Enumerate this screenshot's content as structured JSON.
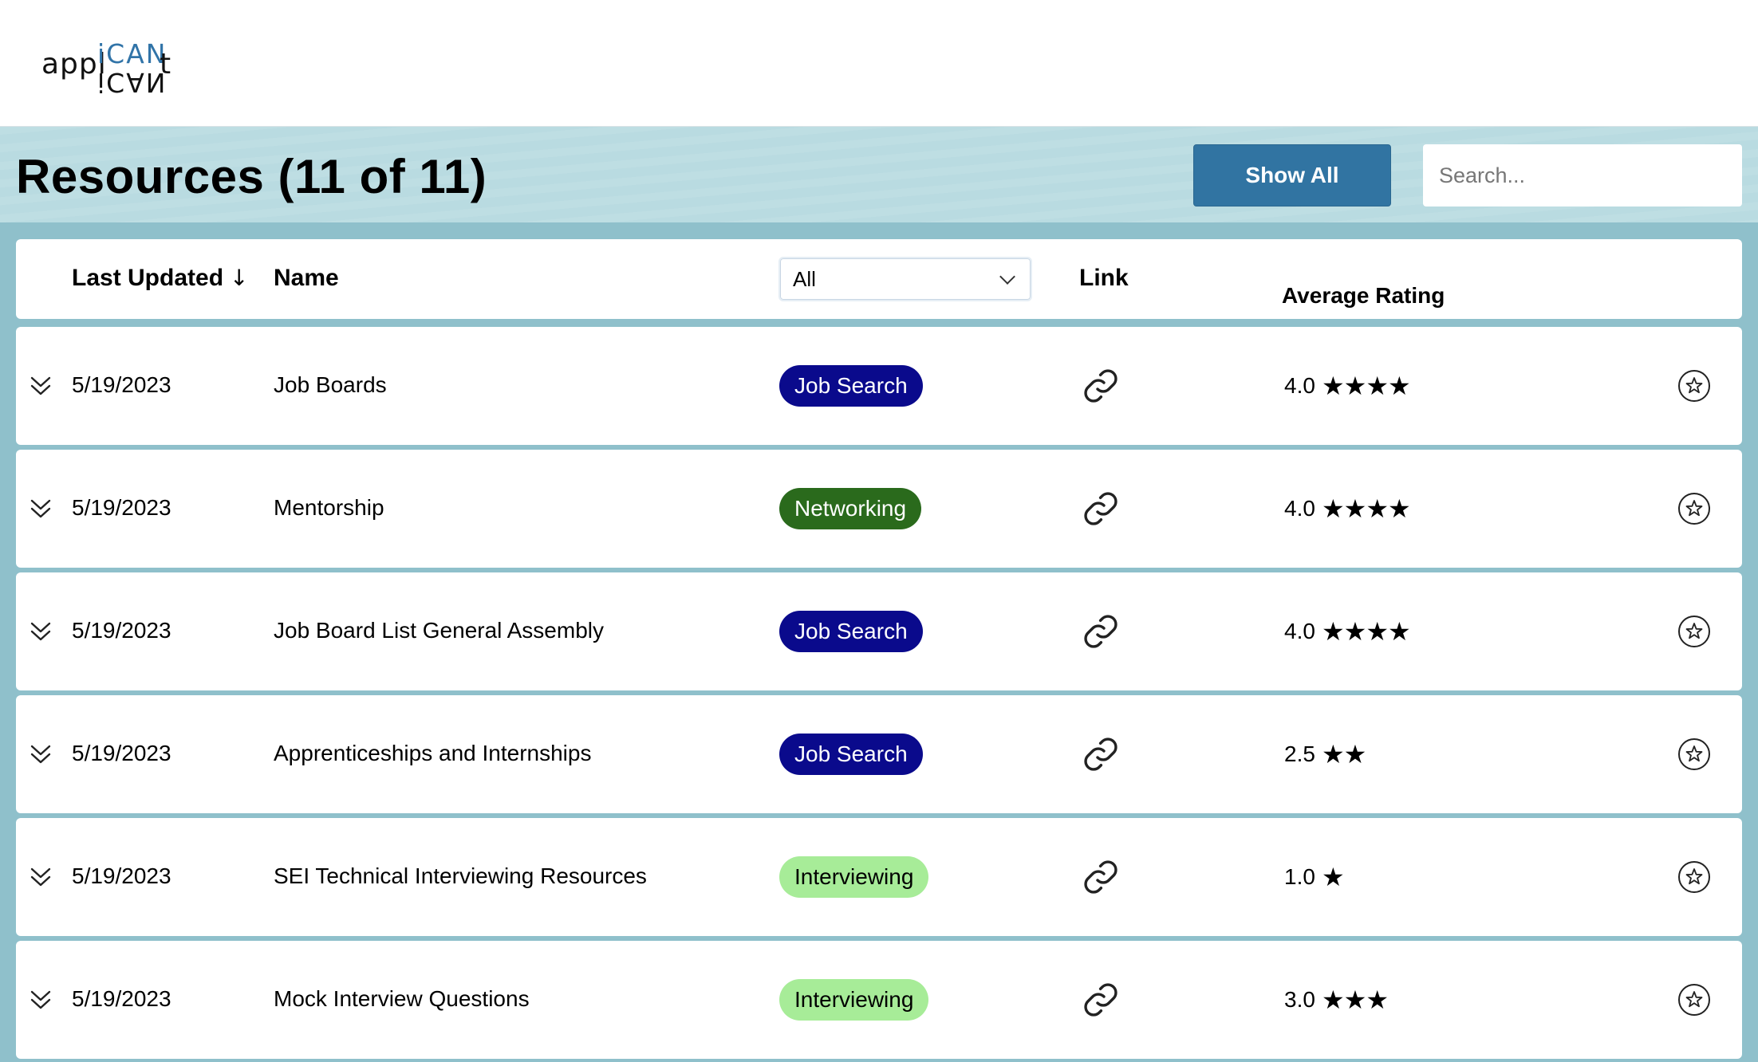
{
  "app": {
    "logo_left": "appl",
    "logo_can": "iCAN",
    "logo_right": "t"
  },
  "toolbar": {
    "title": "Resources (11 of 11)",
    "show_all_label": "Show All",
    "search_placeholder": "Search...",
    "search_value": ""
  },
  "table": {
    "headers": {
      "last_updated": "Last Updated",
      "sort_indicator": "↓",
      "name": "Name",
      "category_filter": "All",
      "link": "Link",
      "average_rating": "Average Rating"
    },
    "rows": [
      {
        "date": "5/19/2023",
        "name": "Job Boards",
        "category": "Job Search",
        "rating": "4.0",
        "stars": "★★★★"
      },
      {
        "date": "5/19/2023",
        "name": "Mentorship",
        "category": "Networking",
        "rating": "4.0",
        "stars": "★★★★"
      },
      {
        "date": "5/19/2023",
        "name": "Job Board List General Assembly",
        "category": "Job Search",
        "rating": "4.0",
        "stars": "★★★★"
      },
      {
        "date": "5/19/2023",
        "name": "Apprenticeships and Internships",
        "category": "Job Search",
        "rating": "2.5",
        "stars": "★★"
      },
      {
        "date": "5/19/2023",
        "name": "SEI Technical Interviewing Resources",
        "category": "Interviewing",
        "rating": "1.0",
        "stars": "★"
      },
      {
        "date": "5/19/2023",
        "name": "Mock Interview Questions",
        "category": "Interviewing",
        "rating": "3.0",
        "stars": "★★★"
      }
    ]
  },
  "colors": {
    "accent": "#3174a2",
    "page_background": "#8fc0cb",
    "title_band": "#b9dbe1",
    "category_job_search_bg": "#0a0a8c",
    "category_job_search_fg": "#ffffff",
    "category_networking_bg": "#2a6a1c",
    "category_networking_fg": "#ffffff",
    "category_interviewing_bg": "#a7ec98",
    "category_interviewing_fg": "#000000"
  },
  "icons": {
    "expand": "chevron-double-down-icon",
    "link": "link-icon",
    "favorite": "star-circle-icon",
    "select": "chevron-down-icon"
  }
}
